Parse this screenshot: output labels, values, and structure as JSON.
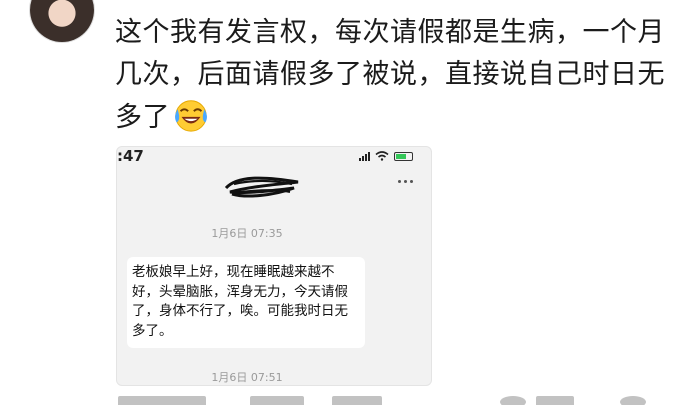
{
  "comment": {
    "text": "这个我有发言权，每次请假都是生病，一个月几次，后面请假多了被说，直接说自己时日无多了",
    "emoji": "crying-laughing-emoji"
  },
  "screenshot": {
    "status_time": ":47",
    "chat": {
      "timestamp_top": "1月6日 07:35",
      "message": "老板娘早上好，现在睡眠越来越不好，头晕脑胀，浑身无力，今天请假了，身体不行了，唉。可能我时日无多了。",
      "timestamp_bottom": "1月6日 07:51"
    }
  }
}
